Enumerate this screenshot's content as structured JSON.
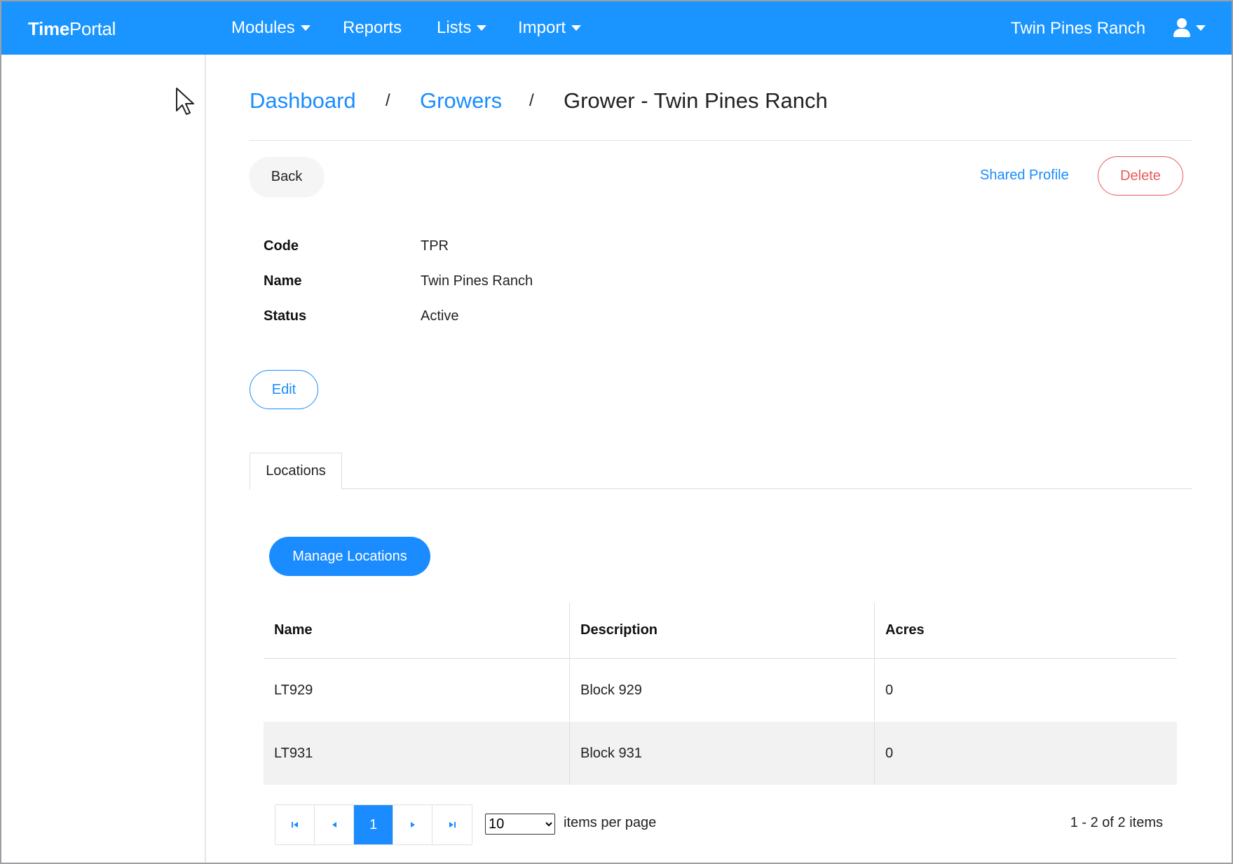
{
  "app": {
    "brand_bold": "Time",
    "brand_light": "Portal",
    "org_name": "Twin Pines Ranch",
    "accent_color": "#1a94ff"
  },
  "nav": {
    "items": [
      {
        "label": "Modules",
        "has_dropdown": true
      },
      {
        "label": "Reports",
        "has_dropdown": false
      },
      {
        "label": "Lists",
        "has_dropdown": true
      },
      {
        "label": "Import",
        "has_dropdown": true
      }
    ],
    "user_icon": "user-icon"
  },
  "breadcrumb": {
    "items": [
      "Dashboard",
      "Growers"
    ],
    "separator": "/",
    "current": "Grower - Twin Pines Ranch"
  },
  "actions": {
    "back_label": "Back",
    "shared_profile_label": "Shared Profile",
    "delete_label": "Delete",
    "edit_label": "Edit",
    "delete_color": "#e85a5a"
  },
  "details": [
    {
      "label": "Code",
      "value": "TPR"
    },
    {
      "label": "Name",
      "value": "Twin Pines Ranch"
    },
    {
      "label": "Status",
      "value": "Active"
    }
  ],
  "tabs": [
    {
      "label": "Locations",
      "active": true
    }
  ],
  "locations": {
    "manage_label": "Manage Locations",
    "columns": [
      "Name",
      "Description",
      "Acres"
    ],
    "rows": [
      [
        "LT929",
        "Block 929",
        "0"
      ],
      [
        "LT931",
        "Block 931",
        "0"
      ]
    ]
  },
  "pager": {
    "current_page": "1",
    "page_size": "10",
    "page_size_options": [
      "10"
    ],
    "items_per_page_label": "items per page",
    "info": "1 - 2 of 2 items"
  }
}
